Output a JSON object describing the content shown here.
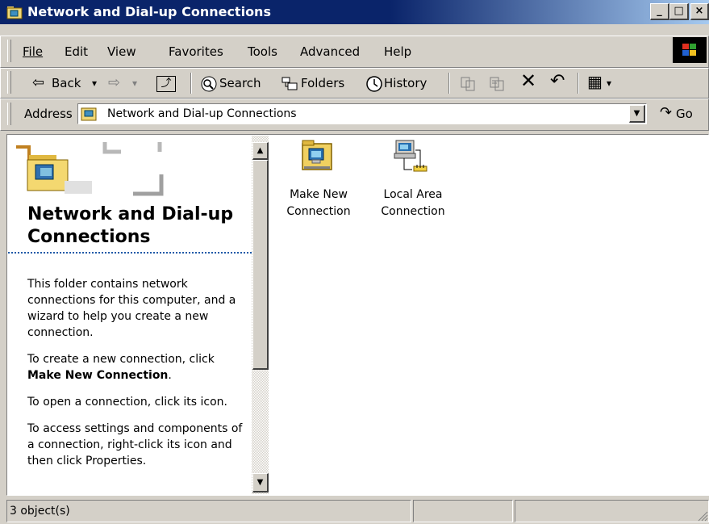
{
  "window": {
    "title": "Network and Dial-up Connections"
  },
  "title_buttons": {
    "minimize": "_",
    "maximize": "□",
    "close": "×"
  },
  "menu": [
    {
      "label": "File"
    },
    {
      "label": "Edit"
    },
    {
      "label": "View"
    },
    {
      "label": "Favorites"
    },
    {
      "label": "Tools"
    },
    {
      "label": "Advanced"
    },
    {
      "label": "Help"
    }
  ],
  "toolbar": {
    "back": "Back",
    "back_arrow": "⇦",
    "forward_arrow": "⇨",
    "dropdown": "▾",
    "up": "⤴",
    "search": "Search",
    "folders": "Folders",
    "history": "History",
    "delete": "✕",
    "undo": "↶",
    "views": "▦"
  },
  "address": {
    "label": "Address",
    "value": "Network and Dial-up Connections",
    "go": "Go",
    "go_icon": "↷"
  },
  "left_panel": {
    "heading": "Network and Dial-up Connections",
    "p1": "This folder contains network connections for this computer, and a wizard to help you create a new connection.",
    "p2_prefix": "To create a new connection, click",
    "p2_bold": "Make New Connection",
    "p2_suffix": ".",
    "p3": "To open a connection, click its icon.",
    "p4": "To access settings and components of a connection, right-click its icon and then click Properties."
  },
  "items": [
    {
      "line1": "Make New",
      "line2": "Connection",
      "icon": "make-new-connection-icon"
    },
    {
      "line1": "Local Area",
      "line2": "Connection",
      "icon": "local-area-connection-icon"
    }
  ],
  "status": {
    "text": "3 object(s)"
  },
  "scroll_arrows": {
    "up": "▲",
    "down": "▼"
  },
  "colors": {
    "titlebar_start": "#0a246a",
    "titlebar_end": "#a6caf0",
    "face": "#d4d0c8",
    "heading_rule": "#1e5aa8"
  }
}
